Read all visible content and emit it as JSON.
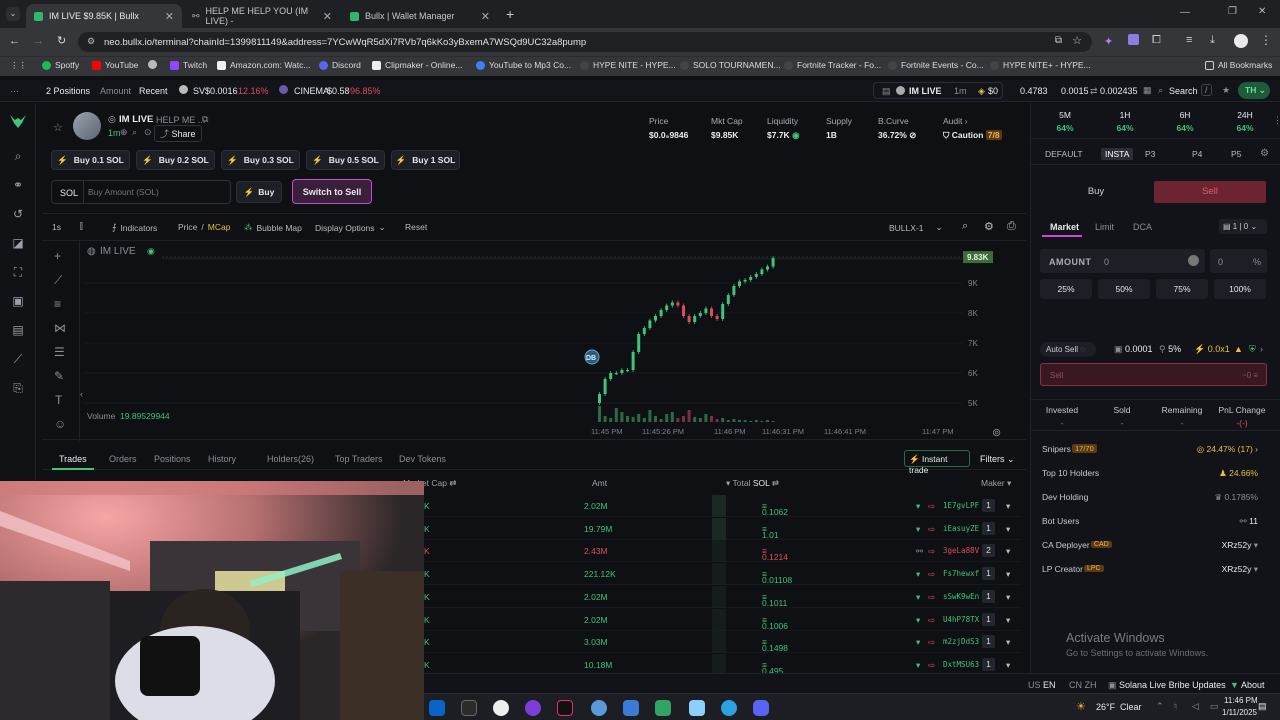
{
  "browser": {
    "tabs": [
      {
        "label": "IM LIVE $9.85K | Bullx",
        "active": true
      },
      {
        "label": "HELP ME HELP YOU (IM LIVE) -",
        "active": false
      },
      {
        "label": "Bullx | Wallet Manager",
        "active": false
      }
    ],
    "url": "neo.bullx.io/terminal?chainId=1399811149&address=7YCwWqR5dXi7RVb7q6kKo3yBxemA7WSQd9UC32a8pump",
    "bookmarks": [
      "Spotfy",
      "YouTube",
      "Twitch",
      "Amazon.com: Watc...",
      "Discord",
      "Clipmaker - Online...",
      "YouTube to Mp3 Co...",
      "HYPE NITE - HYPE...",
      "SOLO TOURNAMEN...",
      "Fortnite Tracker - Fo...",
      "Fortnite Events - Co...",
      "HYPE NITE+ - HYPE..."
    ],
    "all_bookmarks": "All Bookmarks"
  },
  "topbar": {
    "positions": "2 Positions",
    "amount": "Amount",
    "recent": "Recent",
    "ticker1_name": "SV",
    "ticker1_price": "$0.0016",
    "ticker1_change": "-12.16%",
    "ticker2_name": "CINEMA",
    "ticker2_price": "$0.58",
    "ticker2_change": "-96.85%",
    "token_name": "IM LIVE",
    "token_time": "1m",
    "token_bal": "$0",
    "balance1": "0.4783",
    "balance2": "0.0015",
    "balance3": "0.002435",
    "search": "Search",
    "search_key": "/",
    "user": "TH"
  },
  "token": {
    "name": "IM LIVE",
    "subtitle": "HELP ME ...",
    "age": "1m",
    "share": "Share",
    "stats": [
      {
        "label": "Price",
        "value": "$0.0₅9846"
      },
      {
        "label": "Mkt Cap",
        "value": "$9.85K"
      },
      {
        "label": "Liquidity",
        "value": "$7.7K"
      },
      {
        "label": "Supply",
        "value": "1B"
      },
      {
        "label": "B.Curve",
        "value": "36.72%"
      },
      {
        "label": "Audit",
        "value": "Caution",
        "badge": "7/8"
      }
    ],
    "quick_buys": [
      "Buy 0.1 SOL",
      "Buy 0.2 SOL",
      "Buy 0.3 SOL",
      "Buy 0.5 SOL",
      "Buy 1 SOL"
    ],
    "sol_prefix": "SOL",
    "buy_amount_placeholder": "Buy Amount (SOL)",
    "buy": "Buy",
    "switch_to_sell": "Switch to Sell"
  },
  "chart_toolbar": {
    "interval": "1s",
    "indicators": "Indicators",
    "price": "Price",
    "mcap": "MCap",
    "bubble_map": "Bubble Map",
    "display_options": "Display Options",
    "reset": "Reset",
    "chart_id": "BULLX-1"
  },
  "chart_data": {
    "type": "candlestick",
    "title": "IM LIVE",
    "last_value_label": "9.83K",
    "y_ticks": [
      "9K",
      "8K",
      "7K",
      "6K",
      "5K"
    ],
    "x_ticks": [
      "11:45 PM",
      "11:45:26 PM",
      "11:46 PM",
      "11:46:31 PM",
      "11:46:41 PM",
      "11:47 PM"
    ],
    "marker": "DB",
    "volume_label": "Volume",
    "volume_value": "19.89529944",
    "candles": [
      {
        "o": 5000,
        "c": 5300,
        "up": true
      },
      {
        "o": 5300,
        "c": 5800,
        "up": true
      },
      {
        "o": 5800,
        "c": 6000,
        "up": true
      },
      {
        "o": 6000,
        "c": 6000,
        "up": true
      },
      {
        "o": 6000,
        "c": 6100,
        "up": true
      },
      {
        "o": 6100,
        "c": 6100,
        "up": true
      },
      {
        "o": 6100,
        "c": 6700,
        "up": true
      },
      {
        "o": 6700,
        "c": 7300,
        "up": true
      },
      {
        "o": 7300,
        "c": 7500,
        "up": true
      },
      {
        "o": 7500,
        "c": 7750,
        "up": true
      },
      {
        "o": 7750,
        "c": 7900,
        "up": true
      },
      {
        "o": 7900,
        "c": 8100,
        "up": true
      },
      {
        "o": 8100,
        "c": 8250,
        "up": true
      },
      {
        "o": 8250,
        "c": 8350,
        "up": true
      },
      {
        "o": 8350,
        "c": 8250,
        "up": false
      },
      {
        "o": 8250,
        "c": 7900,
        "up": false
      },
      {
        "o": 7900,
        "c": 7700,
        "up": false
      },
      {
        "o": 7700,
        "c": 7900,
        "up": true
      },
      {
        "o": 7900,
        "c": 8000,
        "up": true
      },
      {
        "o": 8000,
        "c": 8150,
        "up": true
      },
      {
        "o": 8150,
        "c": 7900,
        "up": false
      },
      {
        "o": 7900,
        "c": 7800,
        "up": false
      },
      {
        "o": 7800,
        "c": 8300,
        "up": true
      },
      {
        "o": 8300,
        "c": 8600,
        "up": true
      },
      {
        "o": 8600,
        "c": 8900,
        "up": true
      },
      {
        "o": 8900,
        "c": 9050,
        "up": true
      },
      {
        "o": 9050,
        "c": 9100,
        "up": true
      },
      {
        "o": 9100,
        "c": 9200,
        "up": true
      },
      {
        "o": 9200,
        "c": 9300,
        "up": true
      },
      {
        "o": 9300,
        "c": 9450,
        "up": true
      },
      {
        "o": 9450,
        "c": 9550,
        "up": true
      },
      {
        "o": 9550,
        "c": 9830,
        "up": true
      }
    ]
  },
  "tabs": {
    "items": [
      "Trades",
      "Orders",
      "Positions",
      "History",
      "Holders(26)",
      "Top Traders",
      "Dev Tokens"
    ],
    "instant_trade": "Instant trade",
    "filters": "Filters"
  },
  "trades": {
    "headers": {
      "market_cap": "Market Cap",
      "amt": "Amt",
      "total": "Total",
      "sol": "SOL",
      "maker": "Maker"
    },
    "rows": [
      {
        "amt": "2.02M",
        "total": "0.1062",
        "maker": "1E7gvLPF",
        "count": "1",
        "side": "buy"
      },
      {
        "amt": "19.79M",
        "total": "1.01",
        "maker": "iEasuyZE",
        "count": "1",
        "side": "buy"
      },
      {
        "amt": "2.43M",
        "total": "0.1214",
        "maker": "3geLa88V",
        "count": "2",
        "side": "sell"
      },
      {
        "amt": "221.12K",
        "total": "0.01108",
        "maker": "Fs7hewxf",
        "count": "1",
        "side": "buy"
      },
      {
        "amt": "2.02M",
        "total": "0.1011",
        "maker": "sSwK9wEn",
        "count": "1",
        "side": "buy"
      },
      {
        "amt": "2.02M",
        "total": "0.1006",
        "maker": "U4hP78TX",
        "count": "1",
        "side": "buy"
      },
      {
        "amt": "3.03M",
        "total": "0.1498",
        "maker": "m2zjDdS3",
        "count": "1",
        "side": "buy"
      },
      {
        "amt": "10.18M",
        "total": "0.495",
        "maker": "DxtMSU63",
        "count": "1",
        "side": "buy"
      }
    ]
  },
  "right_panel": {
    "timeframes": [
      {
        "label": "5M",
        "value": "64%"
      },
      {
        "label": "1H",
        "value": "64%"
      },
      {
        "label": "6H",
        "value": "64%"
      },
      {
        "label": "24H",
        "value": "64%"
      }
    ],
    "presets": [
      "DEFAULT",
      "INSTA",
      "P3",
      "P4",
      "P5"
    ],
    "buy": "Buy",
    "sell": "Sell",
    "order_types": [
      "Market",
      "Limit",
      "DCA"
    ],
    "wallet_count": "1",
    "wallet_zero": "0",
    "amount_label": "AMOUNT",
    "amount_value": "0",
    "amount_pct": "0",
    "pct_sign": "%",
    "pct_buttons": [
      "25%",
      "50%",
      "75%",
      "100%"
    ],
    "auto_sell": "Auto Sell",
    "fee": "0.0001",
    "slippage": "5%",
    "priority": "0.0x1",
    "sell_input": "Sell",
    "sell_value": "~0",
    "summary": [
      {
        "label": "Invested",
        "value": "-"
      },
      {
        "label": "Sold",
        "value": "-"
      },
      {
        "label": "Remaining",
        "value": "-"
      },
      {
        "label": "PnL Change",
        "value": "-(-)"
      }
    ],
    "snipers_label": "Snipers",
    "snipers_badge": "17/70",
    "snipers_value": "24.47% (17)",
    "top10_label": "Top 10 Holders",
    "top10_value": "24.66%",
    "dev_label": "Dev Holding",
    "dev_value": "0.1785%",
    "bot_label": "Bot Users",
    "bot_value": "11",
    "ca_label": "CA Deployer",
    "ca_badge": "CAD",
    "ca_value": "XRz52y",
    "lp_label": "LP Creator",
    "lp_badge": "LPC",
    "lp_value": "XRz52y"
  },
  "watermark": {
    "title": "Activate Windows",
    "sub": "Go to Settings to activate Windows."
  },
  "statusbar": {
    "lang1": "US",
    "lang1_code": "EN",
    "lang2": "CN",
    "lang2_code": "ZH",
    "news": "Solana Live Bribe Updates",
    "about": "About"
  },
  "taskbar": {
    "weather": "26°F",
    "condition": "Clear",
    "time": "11:46 PM",
    "date": "1/11/2025"
  }
}
